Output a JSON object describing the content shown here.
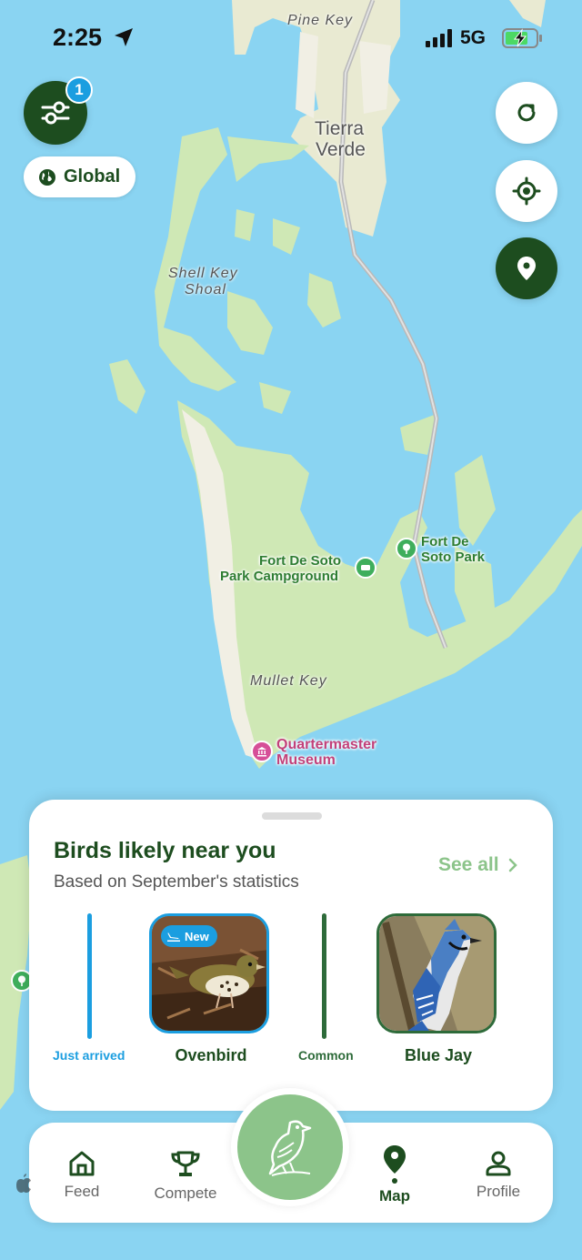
{
  "status_bar": {
    "time": "2:25",
    "network": "5G"
  },
  "filter": {
    "badge_count": "1"
  },
  "scope": {
    "label": "Global"
  },
  "map_labels": {
    "pine_key": "Pine Key",
    "tierra_verde_1": "Tierra",
    "tierra_verde_2": "Verde",
    "shell_key_1": "Shell Key",
    "shell_key_2": "Shoal",
    "fort_desoto_park_1": "Fort De",
    "fort_desoto_park_2": "Soto Park",
    "campground_1": "Fort De Soto",
    "campground_2": "Park Campground",
    "mullet_key": "Mullet Key",
    "museum_1": "Quartermaster",
    "museum_2": "Museum"
  },
  "sheet": {
    "title": "Birds likely near you",
    "subtitle": "Based on September's statistics",
    "see_all": "See all",
    "groups": [
      {
        "category": "Just arrived",
        "bird": "Ovenbird",
        "badge": "New",
        "color": "#1b9ee0"
      },
      {
        "category": "Common",
        "bird": "Blue Jay",
        "color": "#2e6b3a"
      }
    ]
  },
  "tabs": {
    "feed": "Feed",
    "compete": "Compete",
    "map": "Map",
    "profile": "Profile"
  },
  "colors": {
    "dark_green": "#1d4d1f",
    "light_green": "#8cc48a",
    "blue": "#1b9ee0",
    "water": "#8ad4f2",
    "land": "#cfe8b5"
  }
}
